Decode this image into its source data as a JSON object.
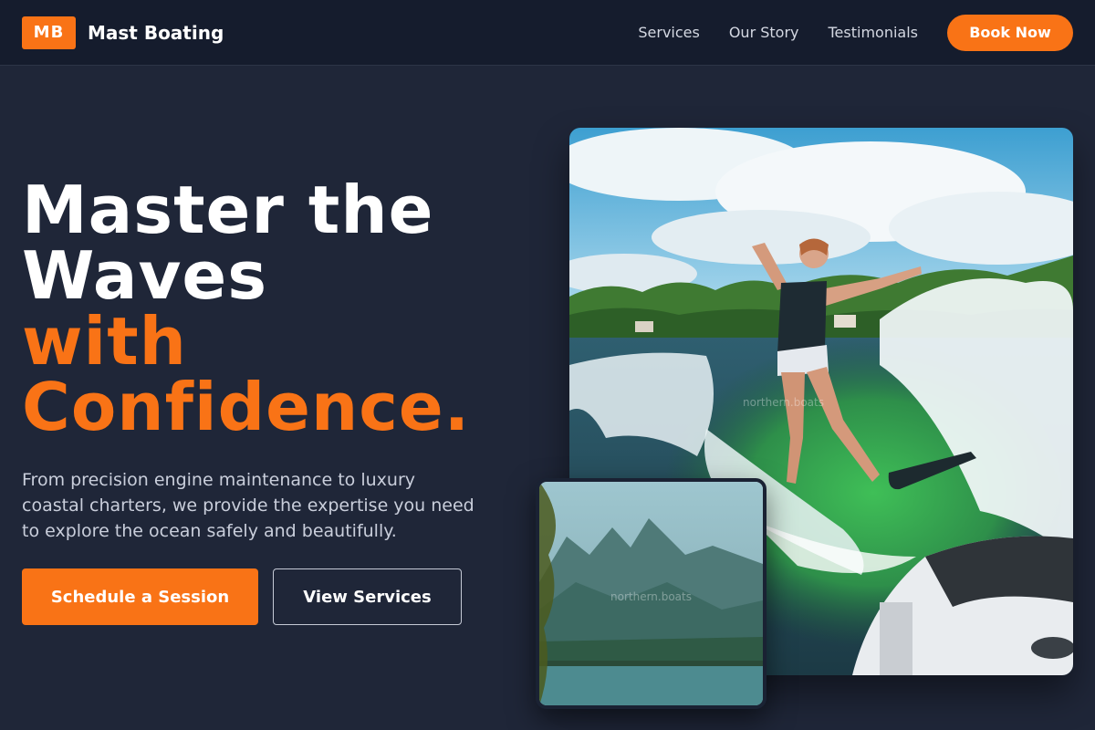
{
  "header": {
    "logo_text": "MB",
    "brand_name": "Mast Boating",
    "nav": [
      "Services",
      "Our Story",
      "Testimonials"
    ],
    "book_label": "Book Now"
  },
  "hero": {
    "headline_line1": "Master the",
    "headline_line2": "Waves",
    "headline_line3": "with",
    "headline_line4": "Confidence.",
    "subtitle": "From precision engine maintenance to luxury coastal charters, we provide the expertise you need to explore the ocean safely and beautifully.",
    "primary_cta": "Schedule a Session",
    "secondary_cta": "View Services"
  },
  "images": {
    "main_watermark": "northern.boats",
    "inset_watermark": "northern.boats"
  },
  "colors": {
    "accent": "#f97316",
    "background": "#1f2638",
    "header_bg": "#151c2d"
  }
}
